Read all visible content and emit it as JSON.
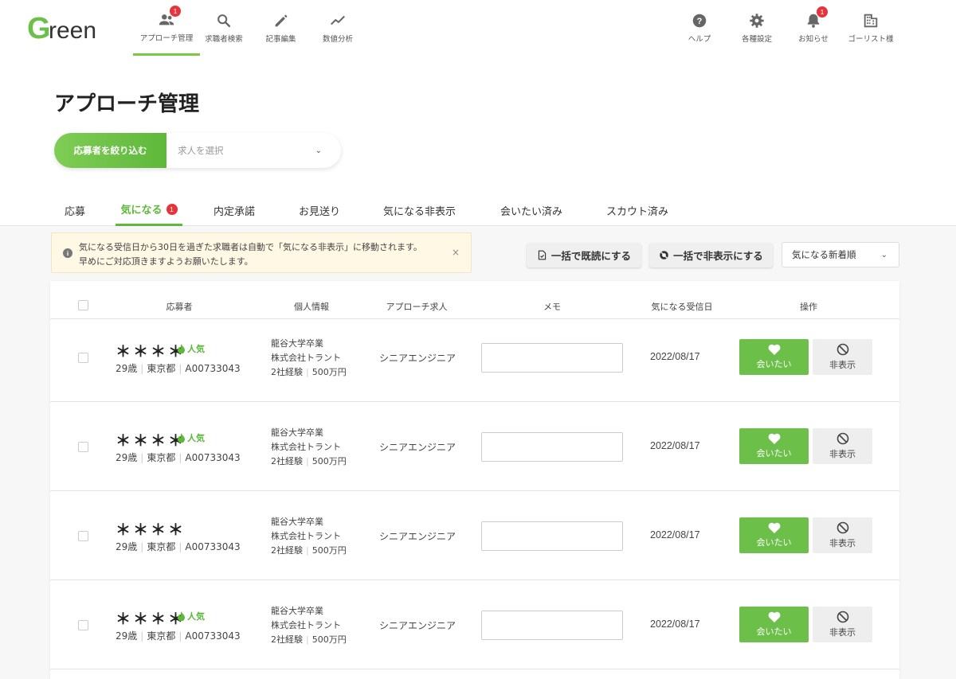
{
  "brand": {
    "logo_text": "Green",
    "accent": "#5eb83a",
    "badge_color": "#e6343a"
  },
  "nav": {
    "left": [
      {
        "label": "アプローチ管理",
        "icon": "people-icon",
        "badge": "1",
        "active": true
      },
      {
        "label": "求職者検索",
        "icon": "search-icon"
      },
      {
        "label": "記事編集",
        "icon": "pencil-icon"
      },
      {
        "label": "数値分析",
        "icon": "trend-icon"
      }
    ],
    "right": [
      {
        "label": "ヘルプ",
        "icon": "help-icon"
      },
      {
        "label": "各種設定",
        "icon": "gear-icon"
      },
      {
        "label": "お知らせ",
        "icon": "bell-icon",
        "badge": "1"
      },
      {
        "label": "ゴーリスト様",
        "icon": "building-icon"
      }
    ]
  },
  "page": {
    "title": "アプローチ管理"
  },
  "filter": {
    "button_label": "応募者を絞り込む",
    "select_placeholder": "求人を選択"
  },
  "tabs": [
    {
      "label": "応募"
    },
    {
      "label": "気になる",
      "badge": "1",
      "active": true
    },
    {
      "label": "内定承諾"
    },
    {
      "label": "お見送り"
    },
    {
      "label": "気になる非表示"
    },
    {
      "label": "会いたい済み"
    },
    {
      "label": "スカウト済み"
    }
  ],
  "notice": {
    "line1": "気になる受信日から30日を過ぎた求職者は自動で「気になる非表示」に移動されます。",
    "line2": "早めにご対応頂きますようお願いたします。",
    "close": "×"
  },
  "actions": {
    "mark_read": "一括で既読にする",
    "hide_all": "一括で非表示にする",
    "sort_value": "気になる新着順"
  },
  "table": {
    "headers": {
      "applicant": "応募者",
      "personal": "個人情報",
      "job": "アプローチ求人",
      "memo": "メモ",
      "date": "気になる受信日",
      "ops": "操作"
    },
    "rows": [
      {
        "name": "＊＊＊＊",
        "popular": "人気",
        "age": "29歳",
        "pref": "東京都",
        "id": "A00733043",
        "school": "龍谷大学卒業",
        "company": "株式会社トラント",
        "exp": "2社経験",
        "salary": "500万円",
        "job": "シニアエンジニア",
        "date": "2022/08/17",
        "meet": "会いたい",
        "hide": "非表示"
      },
      {
        "name": "＊＊＊＊",
        "popular": "人気",
        "age": "29歳",
        "pref": "東京都",
        "id": "A00733043",
        "school": "龍谷大学卒業",
        "company": "株式会社トラント",
        "exp": "2社経験",
        "salary": "500万円",
        "job": "シニアエンジニア",
        "date": "2022/08/17",
        "meet": "会いたい",
        "hide": "非表示"
      },
      {
        "name": "＊＊＊＊",
        "popular": "",
        "age": "29歳",
        "pref": "東京都",
        "id": "A00733043",
        "school": "龍谷大学卒業",
        "company": "株式会社トラント",
        "exp": "2社経験",
        "salary": "500万円",
        "job": "シニアエンジニア",
        "date": "2022/08/17",
        "meet": "会いたい",
        "hide": "非表示"
      },
      {
        "name": "＊＊＊＊",
        "popular": "人気",
        "age": "29歳",
        "pref": "東京都",
        "id": "A00733043",
        "school": "龍谷大学卒業",
        "company": "株式会社トラント",
        "exp": "2社経験",
        "salary": "500万円",
        "job": "シニアエンジニア",
        "date": "2022/08/17",
        "meet": "会いたい",
        "hide": "非表示"
      }
    ]
  }
}
